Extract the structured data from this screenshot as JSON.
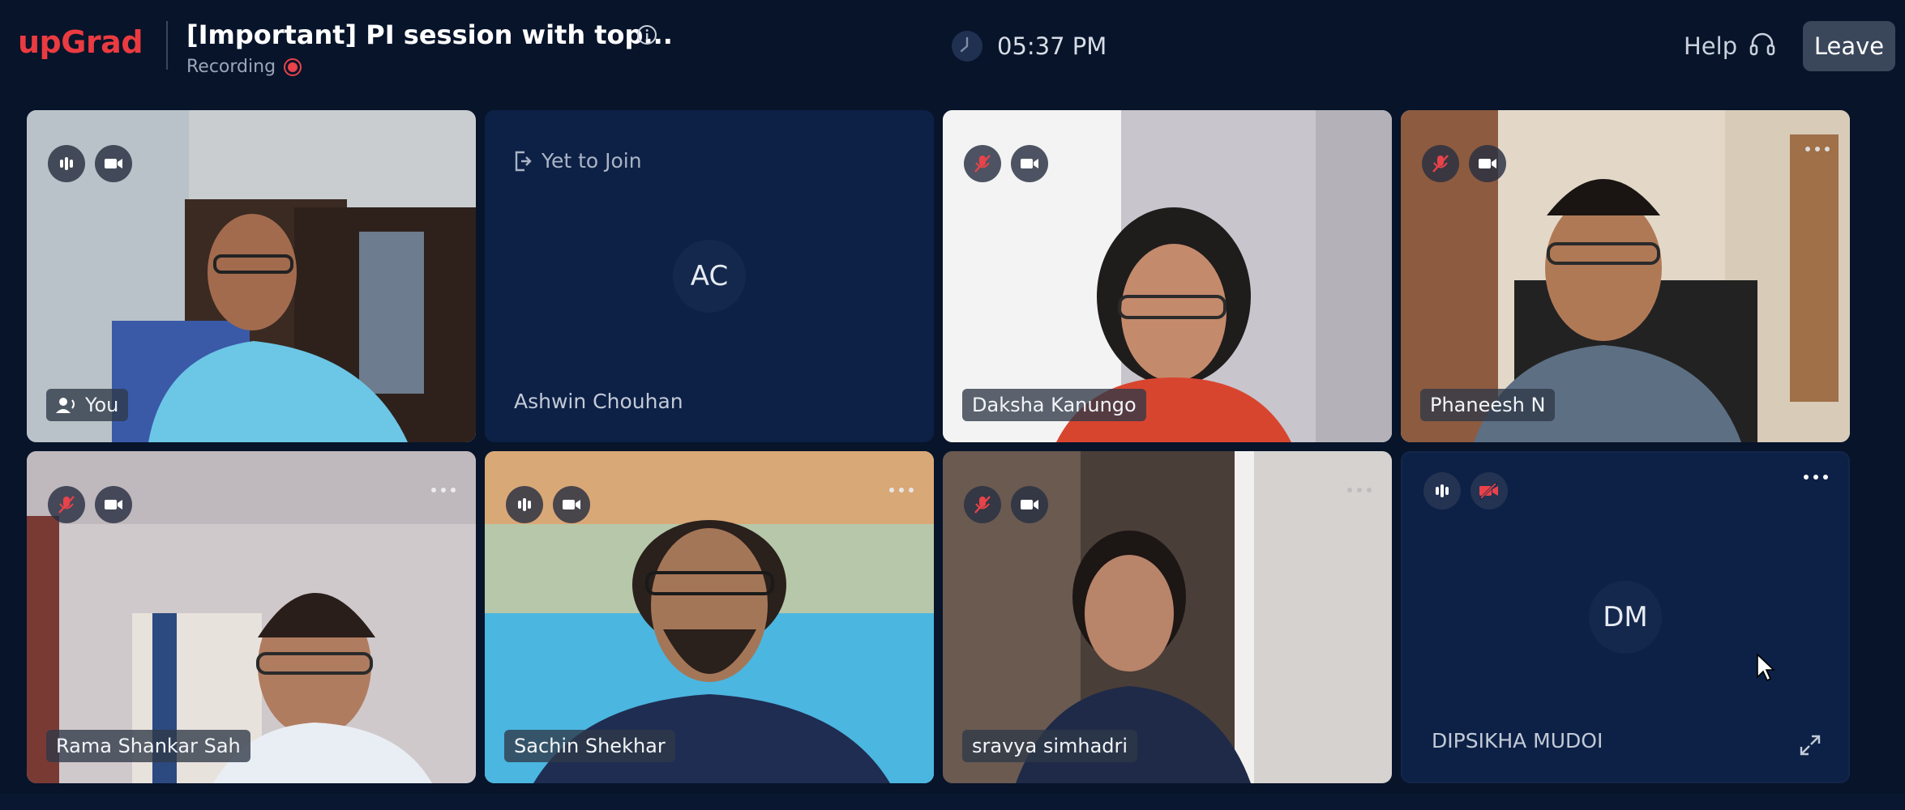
{
  "header": {
    "logo": "upGrad",
    "session_title": "[Important] PI session with top...",
    "recording_label": "Recording",
    "time": "05:37 PM",
    "help_label": "Help",
    "leave_label": "Leave"
  },
  "colors": {
    "brand": "#ea3b41",
    "background": "#07142a",
    "tile_bg": "#0d2147",
    "recording": "#e8434a",
    "muted": "#e8434a"
  },
  "participants": [
    {
      "name": "You",
      "mic": "speaking",
      "camera": "on",
      "video": true
    },
    {
      "name": "Ashwin Chouhan",
      "status": "Yet to Join",
      "initials": "AC",
      "video": false
    },
    {
      "name": "Daksha Kanungo",
      "mic": "muted",
      "camera": "on",
      "video": true
    },
    {
      "name": "Phaneesh N",
      "mic": "muted",
      "camera": "on",
      "video": true
    },
    {
      "name": "Rama Shankar Sah",
      "mic": "muted",
      "camera": "on",
      "video": true
    },
    {
      "name": "Sachin Shekhar",
      "mic": "speaking",
      "camera": "on",
      "video": true
    },
    {
      "name": "sravya simhadri",
      "mic": "muted",
      "camera": "on",
      "video": true
    },
    {
      "name": "DIPSIKHA MUDOI",
      "initials": "DM",
      "mic": "speaking",
      "camera": "off",
      "video": false
    }
  ],
  "icons": [
    "info-icon",
    "recording-icon",
    "clock-icon",
    "headset-icon",
    "mic-icon",
    "mic-off-icon",
    "camera-icon",
    "camera-off-icon",
    "more-icon",
    "exit-icon",
    "expand-icon",
    "cursor-icon"
  ]
}
